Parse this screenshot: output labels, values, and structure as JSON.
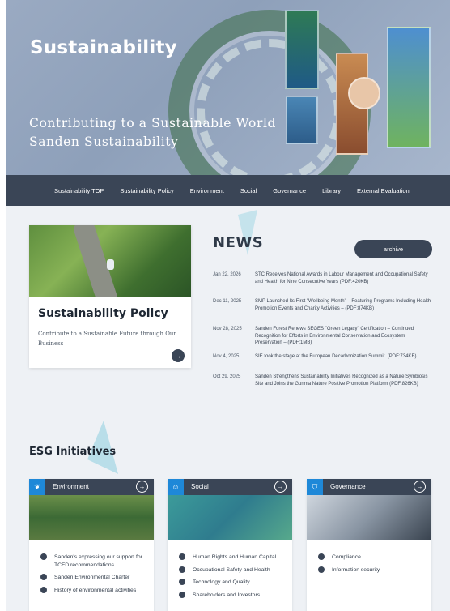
{
  "hero": {
    "title": "Sustainability",
    "subtitle_line1": "Contributing to a Sustainable World",
    "subtitle_line2": "Sanden Sustainability"
  },
  "nav": {
    "items": [
      "Sustainability TOP",
      "Sustainability Policy",
      "Environment",
      "Social",
      "Governance",
      "Library",
      "External Evaluation"
    ]
  },
  "policy": {
    "title": "Sustainability Policy",
    "description": "Contribute to a Sustainable Future through Our Business",
    "button_icon": "arrow-right-icon"
  },
  "news": {
    "title": "NEWS",
    "archive_label": "archive",
    "items": [
      {
        "date": "Jan 22, 2026",
        "text": "STC Receives National Awards in Labour Management and Occupational Safety and Health for Nine Consecutive Years (PDF:420KB)"
      },
      {
        "date": "Dec 11, 2025",
        "text": "SMP Launched Its First \"Wellbeing Month\" – Featuring Programs Including Health Promotion Events and Charity Activities – (PDF:874KB)"
      },
      {
        "date": "Nov 28, 2025",
        "text": "Sanden Forest Renews SEGES \"Green Legacy\" Certification – Continued Recognition for Efforts in Environmental Conservation and Ecosystem Preservation – (PDF:1MB)"
      },
      {
        "date": "Nov 4, 2025",
        "text": "SIE took the stage at the European Decarbonization Summit. (PDF:734KB)"
      },
      {
        "date": "Oct 29, 2025",
        "text": "Sanden Strengthens Sustainability Initiatives Recognized as a Nature Symbiosis Site and Joins the Gunma Nature Positive Promotion Platform (PDF:826KB)"
      }
    ]
  },
  "esg": {
    "title": "ESG Initiatives",
    "cards": [
      {
        "label": "Environment",
        "icon": "leaf-icon",
        "items": [
          "Sanden's expressing our support for TCFD recommendations",
          "Sanden Environmental Charter",
          "History of environmental activities"
        ]
      },
      {
        "label": "Social",
        "icon": "people-icon",
        "items": [
          "Human Rights and Human Capital",
          "Occupational Safety and Health",
          "Technology and Quality",
          "Shareholders and Investors"
        ]
      },
      {
        "label": "Governance",
        "icon": "shield-icon",
        "items": [
          "Compliance",
          "Information security"
        ]
      }
    ]
  },
  "colors": {
    "nav_bg": "#3a4556",
    "accent_blue": "#1e88d8",
    "hero_bg": "#9aaac2",
    "page_bg": "#eef1f5"
  }
}
